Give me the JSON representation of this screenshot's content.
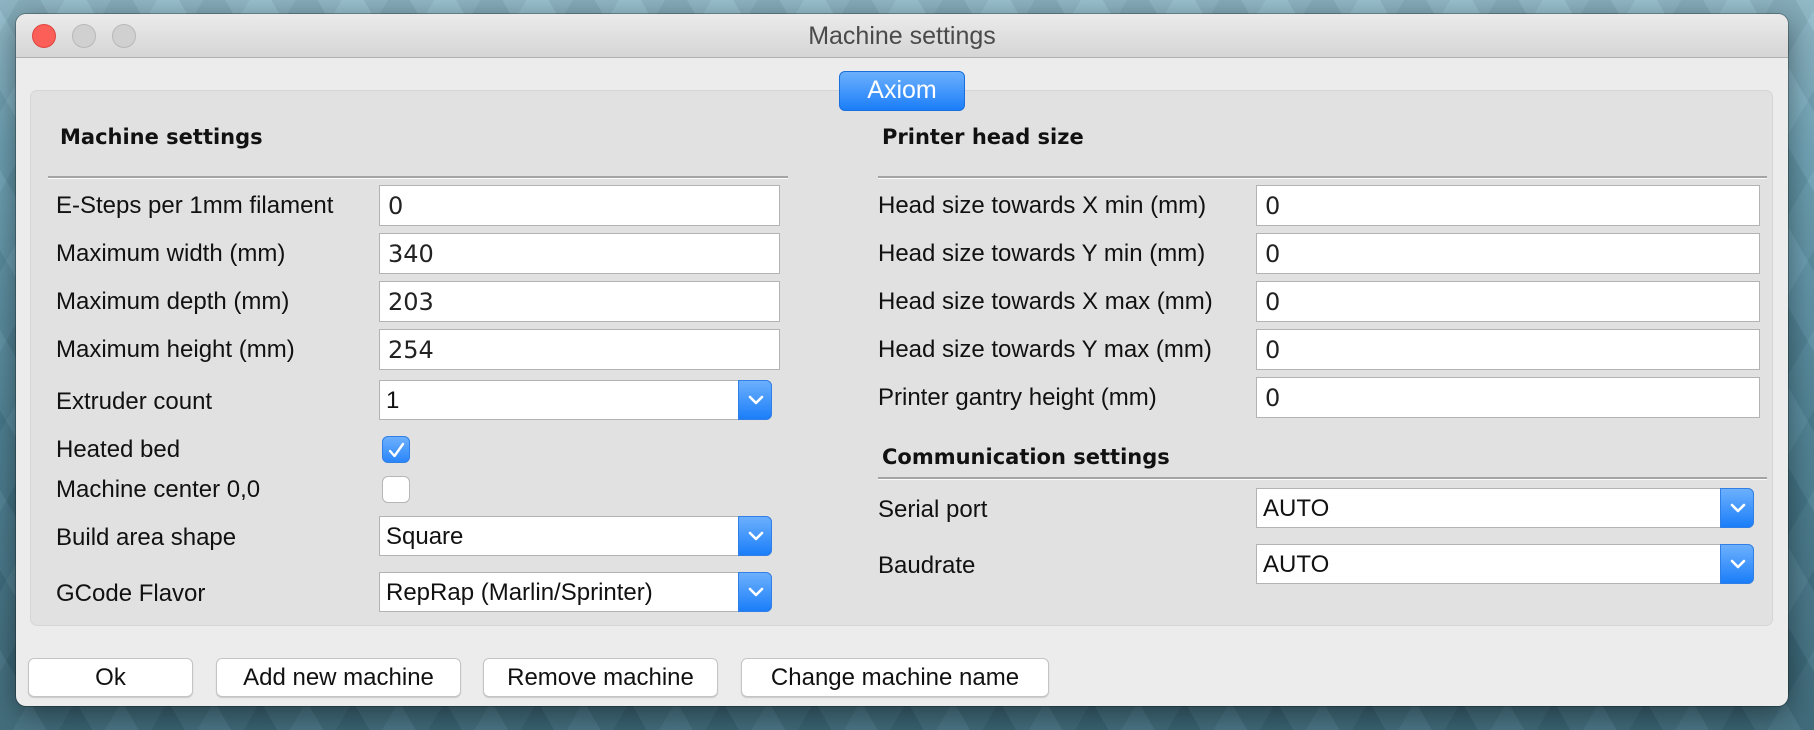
{
  "window": {
    "title": "Machine settings",
    "traffic_lights": [
      "close",
      "minimize",
      "zoom"
    ]
  },
  "tabs": [
    {
      "label": "Axiom",
      "selected": true
    }
  ],
  "machine_settings": {
    "heading": "Machine settings",
    "esteps": {
      "label": "E-Steps per 1mm filament",
      "value": "0"
    },
    "max_width": {
      "label": "Maximum width (mm)",
      "value": "340"
    },
    "max_depth": {
      "label": "Maximum depth (mm)",
      "value": "203"
    },
    "max_height": {
      "label": "Maximum height (mm)",
      "value": "254"
    },
    "extruder_count": {
      "label": "Extruder count",
      "value": "1"
    },
    "heated_bed": {
      "label": "Heated bed",
      "checked": true
    },
    "machine_center": {
      "label": "Machine center 0,0",
      "checked": false
    },
    "build_area_shape": {
      "label": "Build area shape",
      "value": "Square"
    },
    "gcode_flavor": {
      "label": "GCode Flavor",
      "value": "RepRap (Marlin/Sprinter)"
    }
  },
  "printer_head_size": {
    "heading": "Printer head size",
    "x_min": {
      "label": "Head size towards X min (mm)",
      "value": "0"
    },
    "y_min": {
      "label": "Head size towards Y min (mm)",
      "value": "0"
    },
    "x_max": {
      "label": "Head size towards X max (mm)",
      "value": "0"
    },
    "y_max": {
      "label": "Head size towards Y max (mm)",
      "value": "0"
    },
    "gantry_height": {
      "label": "Printer gantry height (mm)",
      "value": "0"
    }
  },
  "communication_settings": {
    "heading": "Communication settings",
    "serial_port": {
      "label": "Serial port",
      "value": "AUTO"
    },
    "baudrate": {
      "label": "Baudrate",
      "value": "AUTO"
    }
  },
  "buttons": {
    "ok": "Ok",
    "add_machine": "Add new machine",
    "remove_machine": "Remove machine",
    "change_name": "Change machine name"
  },
  "colors": {
    "accent": "#1b7ef9",
    "close": "#fc5f57"
  }
}
